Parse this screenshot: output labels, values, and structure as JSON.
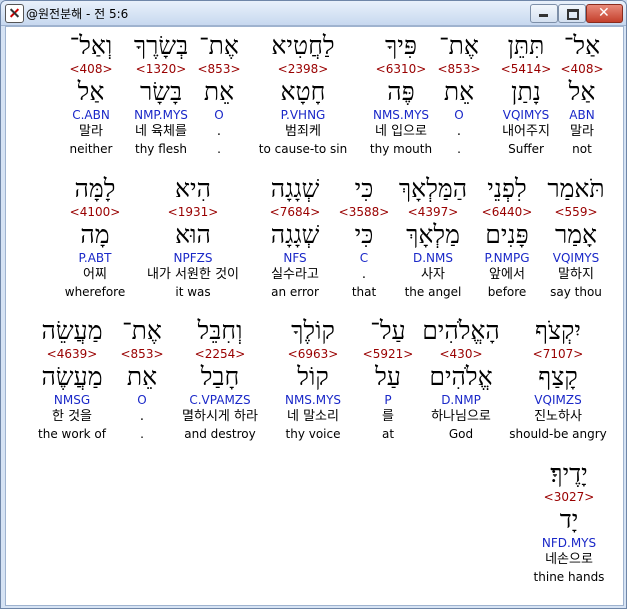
{
  "window": {
    "title": "@원전분해 - 전 5:6",
    "icon": "app-logo-icon",
    "buttons": {
      "minimize": "minimize-icon",
      "maximize": "maximize-icon",
      "close": "close-icon"
    }
  },
  "rows": [
    {
      "words": [
        {
          "word": "אַל־",
          "strong": "<408>",
          "lemma": "אַל",
          "parse": "ABN",
          "ko": "말라",
          "en": "not"
        },
        {
          "word": "תִּתֵּן",
          "strong": "<5414>",
          "lemma": "נָתַן",
          "parse": "VQIMYS",
          "ko": "내어주지",
          "en": "Suffer"
        },
        {
          "word": "אֶת־",
          "strong": "<853>",
          "lemma": "אֵת",
          "parse": "O",
          "ko": ".",
          "en": "."
        },
        {
          "word": "פִּיךָ",
          "strong": "<6310>",
          "lemma": "פֶּה",
          "parse": "NMS.MYS",
          "ko": "네 입으로",
          "en": "thy mouth"
        },
        {
          "word": "לַחֲטִיא",
          "strong": "<2398>",
          "lemma": "חָטָא",
          "parse": "P.VHNG",
          "ko": "범죄케",
          "en": "to cause-to sin"
        },
        {
          "word": "אֶת־",
          "strong": "<853>",
          "lemma": "אֵת",
          "parse": "O",
          "ko": ".",
          "en": "."
        },
        {
          "word": "בְּשָׂרֶךָ",
          "strong": "<1320>",
          "lemma": "בָּשָׂר",
          "parse": "NMP.MYS",
          "ko": "네 육체를",
          "en": "thy flesh"
        },
        {
          "word": "וְאַל־",
          "strong": "<408>",
          "lemma": "אַל",
          "parse": "C.ABN",
          "ko": "말라",
          "en": "neither"
        }
      ]
    },
    {
      "words": [
        {
          "word": "תֹּאמַר",
          "strong": "<559>",
          "lemma": "אָמַר",
          "parse": "VQIMYS",
          "ko": "말하지",
          "en": "say thou"
        },
        {
          "word": "לִפְנֵי",
          "strong": "<6440>",
          "lemma": "פָּנִים",
          "parse": "P.NMPG",
          "ko": "앞에서",
          "en": "before"
        },
        {
          "word": "הַמַּלְאָךְ",
          "strong": "<4397>",
          "lemma": "מַלְאָךְ",
          "parse": "D.NMS",
          "ko": "사자",
          "en": "the angel"
        },
        {
          "word": "כִּי",
          "strong": "<3588>",
          "lemma": "כִּי",
          "parse": "C",
          "ko": ".",
          "en": "that"
        },
        {
          "word": "שְׁגָגָה",
          "strong": "<7684>",
          "lemma": "שְׁגָגָה",
          "parse": "NFS",
          "ko": "실수라고",
          "en": "an error"
        },
        {
          "word": "הִיא",
          "strong": "<1931>",
          "lemma": "הוּא",
          "parse": "NPFZS",
          "ko": "내가 서원한 것이",
          "en": "it was"
        },
        {
          "word": "לָמָּה",
          "strong": "<4100>",
          "lemma": "מָה",
          "parse": "P.ABT",
          "ko": "어찌",
          "en": "wherefore"
        }
      ]
    },
    {
      "words": [
        {
          "word": "יִקְצֹף",
          "strong": "<7107>",
          "lemma": "קָצַף",
          "parse": "VQIMZS",
          "ko": "진노하사",
          "en": "should-be angry"
        },
        {
          "word": "הָאֱלֹהִים",
          "strong": "<430>",
          "lemma": "אֱלֹהִים",
          "parse": "D.NMP",
          "ko": "하나님으로",
          "en": "God"
        },
        {
          "word": "עַל־",
          "strong": "<5921>",
          "lemma": "עַל",
          "parse": "P",
          "ko": "를",
          "en": "at"
        },
        {
          "word": "קוֹלֶךָ",
          "strong": "<6963>",
          "lemma": "קוֹל",
          "parse": "NMS.MYS",
          "ko": "네 말소리",
          "en": "thy voice"
        },
        {
          "word": "וְחִבֵּל",
          "strong": "<2254>",
          "lemma": "חָבַל",
          "parse": "C.VPAMZS",
          "ko": "멸하시게 하라",
          "en": "and destroy"
        },
        {
          "word": "אֶת־",
          "strong": "<853>",
          "lemma": "אֵת",
          "parse": "O",
          "ko": ".",
          "en": "."
        },
        {
          "word": "מַעֲשֵׂה",
          "strong": "<4639>",
          "lemma": "מַעֲשֶׂה",
          "parse": "NMSG",
          "ko": "한 것을",
          "en": "the work of"
        }
      ]
    },
    {
      "words": [
        {
          "word": "יָדֶיךָ׃",
          "strong": "<3027>",
          "lemma": "יָד",
          "parse": "NFD.MYS",
          "ko": "네손으로",
          "en": "thine hands"
        }
      ]
    }
  ]
}
